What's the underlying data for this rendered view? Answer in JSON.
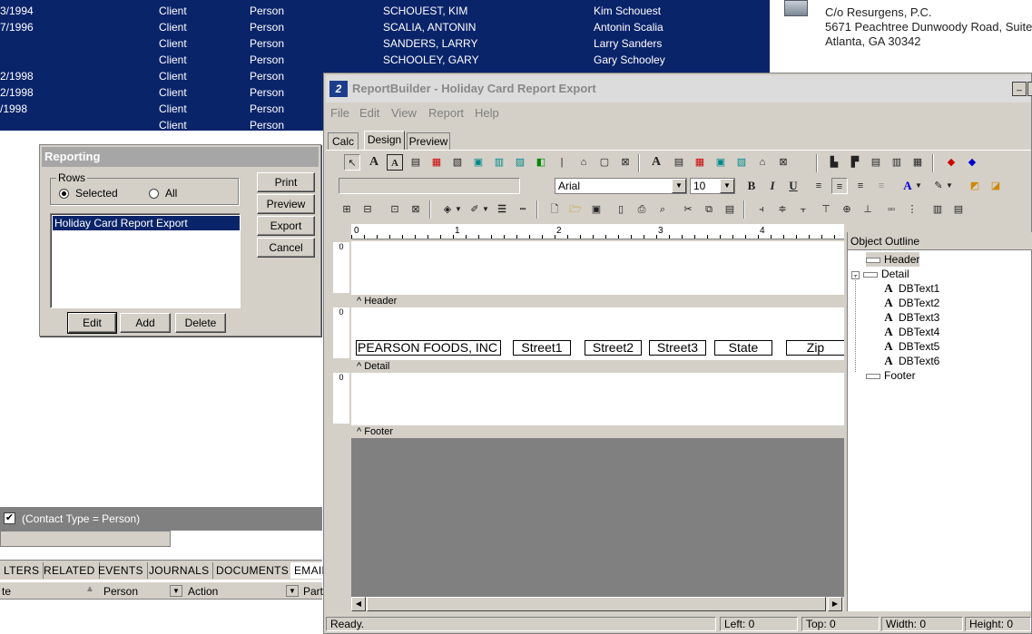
{
  "background_grid": {
    "rows": [
      {
        "date": "3/1994",
        "type": "Client",
        "kind": "Person",
        "name": "SCHOUEST, KIM",
        "display": "Kim Schouest"
      },
      {
        "date": "7/1996",
        "type": "Client",
        "kind": "Person",
        "name": "SCALIA, ANTONIN",
        "display": "Antonin Scalia"
      },
      {
        "date": "",
        "type": "Client",
        "kind": "Person",
        "name": "SANDERS, LARRY",
        "display": "Larry Sanders"
      },
      {
        "date": "",
        "type": "Client",
        "kind": "Person",
        "name": "SCHOOLEY, GARY",
        "display": "Gary Schooley"
      },
      {
        "date": "2/1998",
        "type": "Client",
        "kind": "Person",
        "name": "",
        "display": ""
      },
      {
        "date": "2/1998",
        "type": "Client",
        "kind": "Person",
        "name": "",
        "display": ""
      },
      {
        "date": "/1998",
        "type": "Client",
        "kind": "Person",
        "name": "",
        "display": ""
      },
      {
        "date": "",
        "type": "Client",
        "kind": "Person",
        "name": "",
        "display": ""
      }
    ]
  },
  "contact": {
    "line1": "C/o Resurgens, P.C.",
    "line2": "5671 Peachtree Dunwoody Road, Suite",
    "line3": "Atlanta, GA 30342"
  },
  "filter": {
    "text": "(Contact Type = Person)"
  },
  "bottom_tabs": [
    "LTERS",
    "RELATED",
    "EVENTS",
    "JOURNALS",
    "DOCUMENTS",
    "EMAILS"
  ],
  "bottom_columns": [
    "te",
    "Person",
    "Action",
    "Part"
  ],
  "reporting": {
    "title": "Reporting",
    "rows_label": "Rows",
    "opt_selected": "Selected",
    "opt_all": "All",
    "list_item": "Holiday Card Report Export",
    "print": "Print",
    "preview": "Preview",
    "export": "Export",
    "cancel": "Cancel",
    "edit": "Edit",
    "add": "Add",
    "delete": "Delete"
  },
  "rb": {
    "title": "ReportBuilder - Holiday Card Report Export",
    "menu": [
      "File",
      "Edit",
      "View",
      "Report",
      "Help"
    ],
    "tabs": [
      "Calc",
      "Design",
      "Preview"
    ],
    "font_name": "Arial",
    "font_size": "10",
    "ruler": [
      "0",
      "1",
      "2",
      "3",
      "4"
    ],
    "bands": {
      "header": "Header",
      "detail": "Detail",
      "footer": "Footer"
    },
    "fields": [
      "PEARSON FOODS, INC",
      "Street1",
      "Street2",
      "Street3",
      "State",
      "Zip"
    ],
    "outline": {
      "title": "Object Outline",
      "header": "Header",
      "detail": "Detail",
      "items": [
        "DBText1",
        "DBText2",
        "DBText3",
        "DBText4",
        "DBText5",
        "DBText6"
      ],
      "footer": "Footer"
    },
    "status": {
      "ready": "Ready.",
      "left": "Left: 0",
      "top": "Top: 0",
      "width": "Width: 0",
      "height": "Height: 0"
    }
  }
}
